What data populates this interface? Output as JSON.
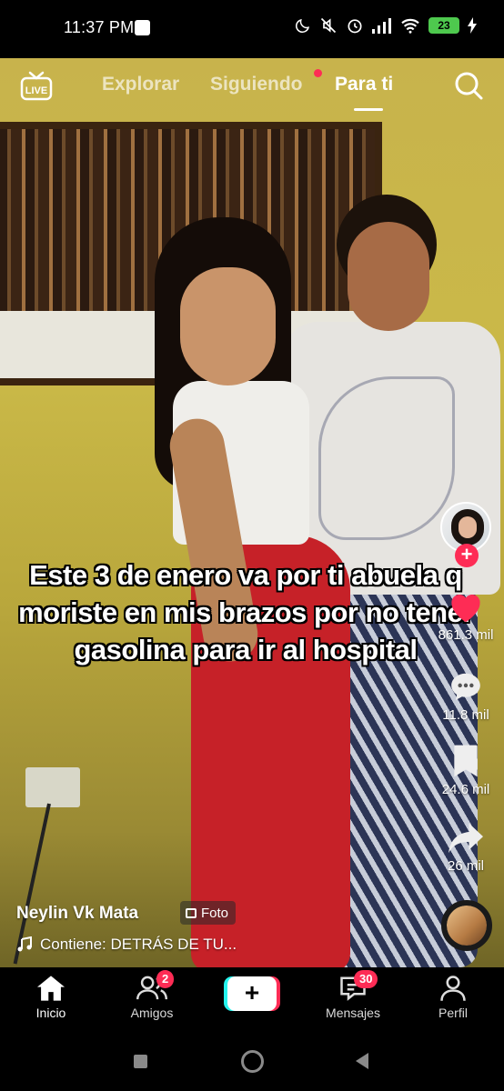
{
  "status_bar": {
    "time": "11:37 PM",
    "battery": "23",
    "icons": [
      "moon-icon",
      "mute-icon",
      "alarm-icon",
      "signal-icon",
      "wifi-icon",
      "battery-icon",
      "charging-icon"
    ]
  },
  "top_nav": {
    "live_label": "LIVE",
    "tabs": [
      {
        "label": "Explorar",
        "active": false
      },
      {
        "label": "Siguiendo",
        "active": false,
        "has_dot": true
      },
      {
        "label": "Para ti",
        "active": true
      }
    ]
  },
  "post": {
    "caption": "Este 3 de enero va por ti abuela q moriste en mis brazos por no tener gasolina para ir al hospital",
    "author": "Neylin Vk Mata",
    "media_badge": "Foto",
    "music": "Contiene: DETRÁS DE TU..."
  },
  "actions": {
    "likes": "861.3 mil",
    "comments": "11.8 mil",
    "saves": "24.6 mil",
    "shares": "26 mil"
  },
  "bottom_nav": {
    "items": [
      {
        "label": "Inicio",
        "active": true
      },
      {
        "label": "Amigos",
        "badge": "2"
      },
      {
        "label": "",
        "kind": "create"
      },
      {
        "label": "Mensajes",
        "badge": "30"
      },
      {
        "label": "Perfil"
      }
    ]
  },
  "colors": {
    "accent": "#fe2c55",
    "cyan": "#25f4ee",
    "battery": "#4ec94e"
  }
}
